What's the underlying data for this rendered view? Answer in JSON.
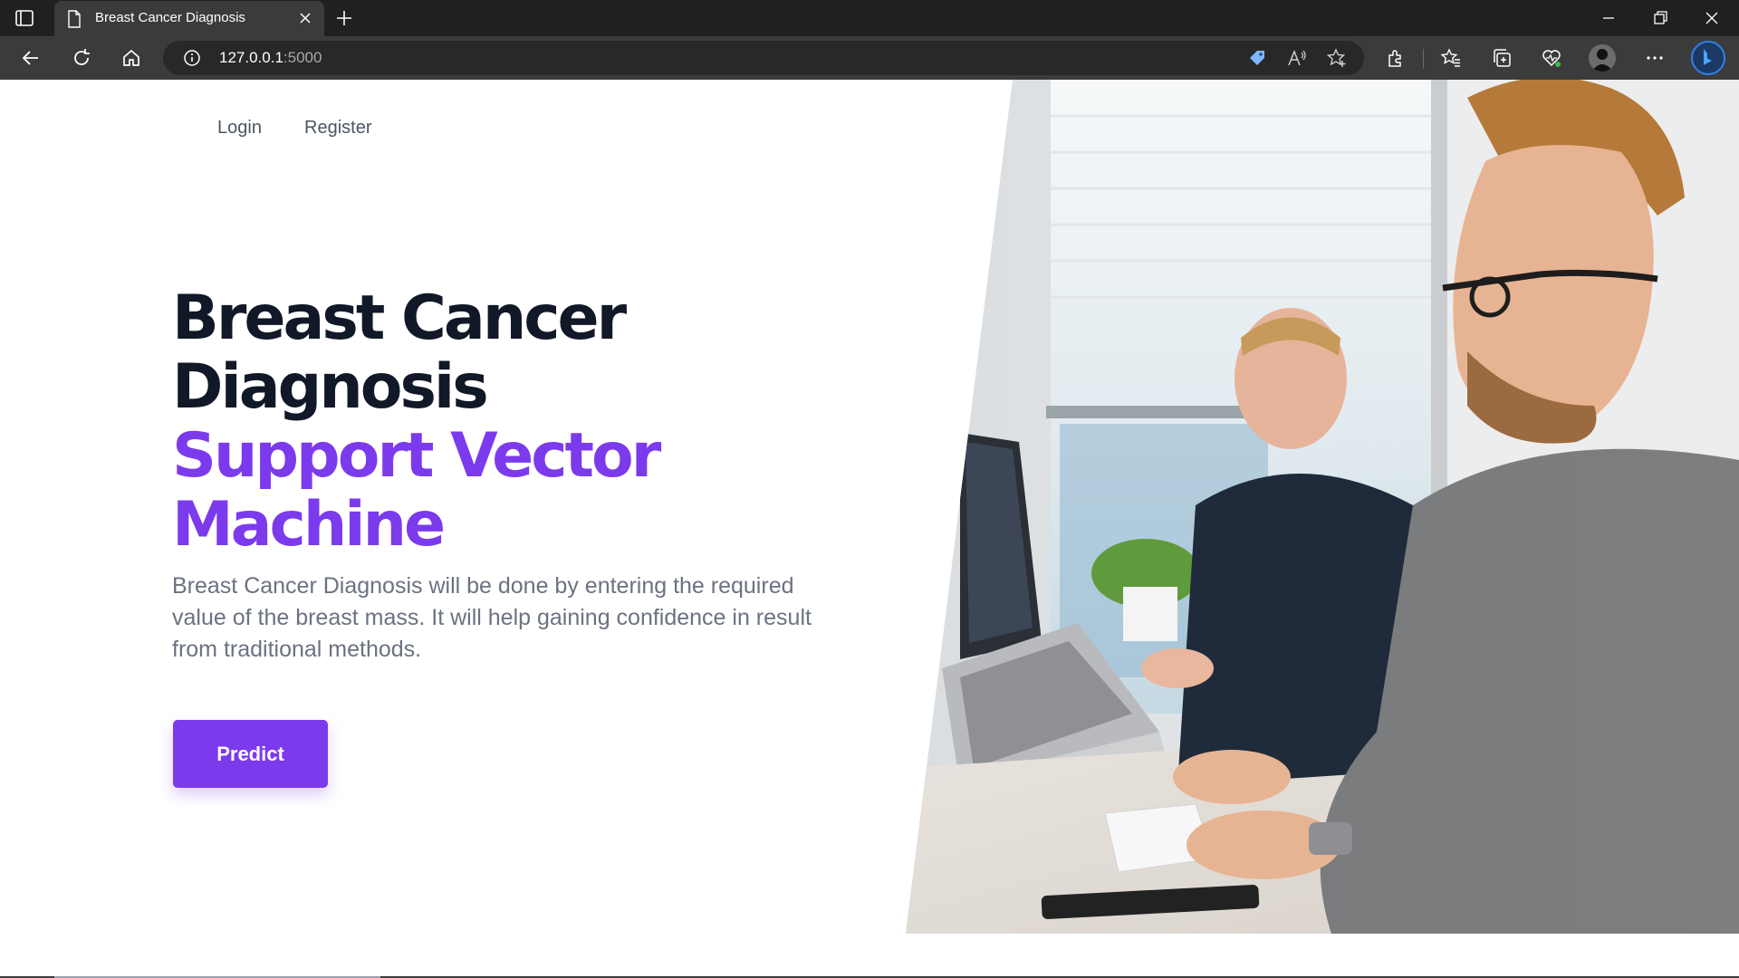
{
  "browser": {
    "tab": {
      "title": "Breast Cancer Diagnosis"
    },
    "address": {
      "host": "127.0.0.1",
      "port": ":5000"
    }
  },
  "page": {
    "nav": {
      "login": "Login",
      "register": "Register"
    },
    "hero": {
      "title_line1": "Breast Cancer",
      "title_line2": "Diagnosis",
      "accent_line1": "Support Vector",
      "accent_line2": "Machine",
      "description": "Breast Cancer Diagnosis will be done by entering the required value of the breast mass. It will help gaining confidence in result from traditional methods.",
      "button": "Predict"
    }
  },
  "colors": {
    "accent": "#7c3aed",
    "heading": "#111827",
    "body_text": "#6b7280",
    "browser_dark": "#202020",
    "browser_toolbar": "#3b3b3b"
  },
  "icons": [
    "tab-actions-icon",
    "page-icon",
    "close-icon",
    "plus-icon",
    "minimize-icon",
    "restore-icon",
    "window-close-icon",
    "back-icon",
    "refresh-icon",
    "home-icon",
    "info-icon",
    "tag-icon",
    "read-aloud-icon",
    "add-favorite-icon",
    "extensions-icon",
    "favorites-icon",
    "collections-icon",
    "browser-essentials-icon",
    "profile-avatar",
    "more-icon",
    "copilot-icon"
  ]
}
